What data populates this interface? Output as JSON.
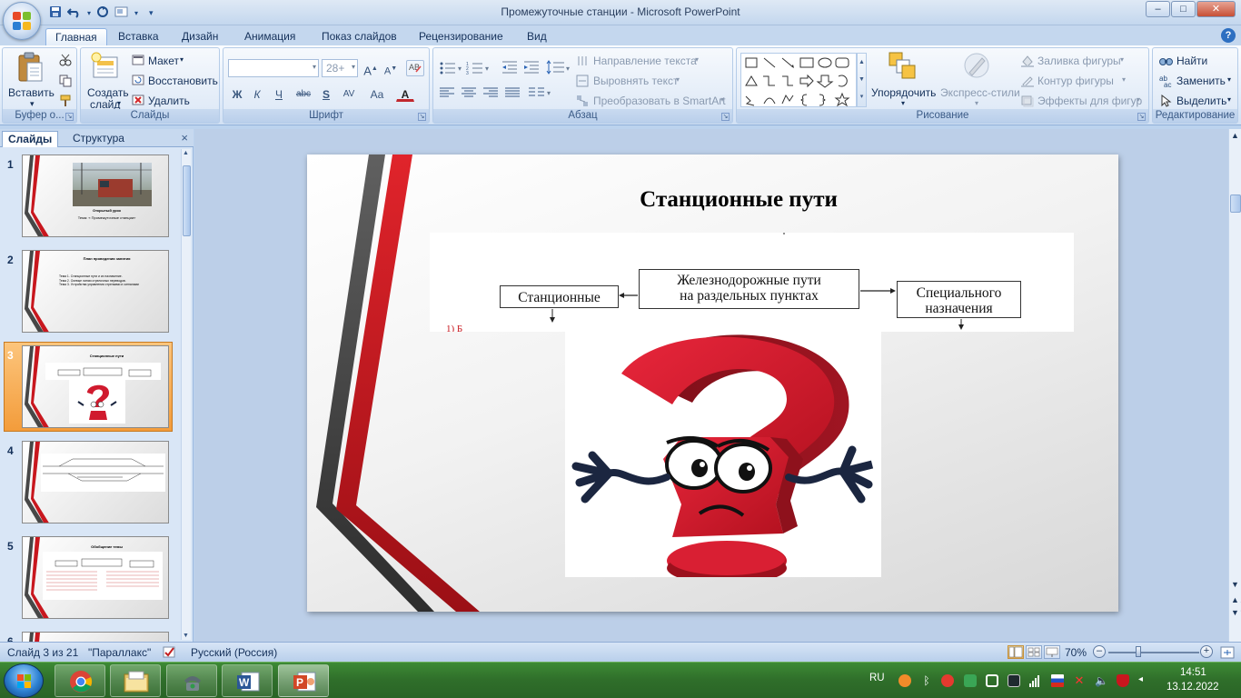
{
  "window": {
    "title": "Промежуточные станции - Microsoft PowerPoint",
    "minimize": "–",
    "maximize": "□",
    "close": "✕"
  },
  "ribbon_tabs": [
    "Главная",
    "Вставка",
    "Дизайн",
    "Анимация",
    "Показ слайдов",
    "Рецензирование",
    "Вид"
  ],
  "ribbon": {
    "clipboard": {
      "paste": "Вставить",
      "label": "Буфер о..."
    },
    "slides": {
      "create1": "Создать",
      "create2": "слайд",
      "layout": "Макет",
      "reset": "Восстановить",
      "delete": "Удалить",
      "label": "Слайды"
    },
    "font": {
      "size_value": "28+",
      "label": "Шрифт",
      "buttons": [
        "Ж",
        "К",
        "Ч",
        "abc",
        "S",
        "AV",
        "Aa",
        "A"
      ]
    },
    "paragraph": {
      "text_direction": "Направление текста",
      "align_text": "Выровнять текст",
      "smartart": "Преобразовать в SmartArt",
      "label": "Абзац"
    },
    "drawing": {
      "arrange1": "Упорядочить",
      "quick_styles": "Экспресс-стили",
      "fill": "Заливка фигуры",
      "outline": "Контур фигуры",
      "effects": "Эффекты для фигур",
      "label": "Рисование"
    },
    "editing": {
      "find": "Найти",
      "replace": "Заменить",
      "select": "Выделить",
      "label": "Редактирование"
    }
  },
  "pane": {
    "tab_slides": "Слайды",
    "tab_outline": "Структура",
    "close": "×",
    "slides": [
      {
        "num": "1",
        "title": "Открытый урок",
        "text": "Тема: « Промежуточные станции»"
      },
      {
        "num": "2",
        "title": "План проведения занятия",
        "text": "Тема 1. Станционные пути и их назначение.\nТема 2. Осевые линии стрелочных переводов.\nТема 3. Устройства управления стрелками и сигналами"
      },
      {
        "num": "3",
        "title": "Станционные пути",
        "text": ""
      },
      {
        "num": "4",
        "title": "",
        "text": ""
      },
      {
        "num": "5",
        "title": "Обобщение темы",
        "text": ""
      },
      {
        "num": "6",
        "title": "",
        "text": ""
      }
    ]
  },
  "slide": {
    "title": "Станционные пути",
    "diagram": {
      "center_line1": "Железнодорожные пути",
      "center_line2": "на раздельных пунктах",
      "left": "Станционные",
      "right_line1": "Специального",
      "right_line2": "назначения"
    }
  },
  "statusbar": {
    "slide_info": "Слайд 3 из 21",
    "theme": "\"Параллакс\"",
    "language": "Русский (Россия)",
    "zoom": "70%",
    "zoom_pct": 70
  },
  "taskbar": {
    "lang": "RU",
    "time": "14:51",
    "date": "13.12.2022"
  },
  "colors": {
    "slide_red": "#c8171e",
    "slide_dark": "#474747",
    "question_red": "#d01a2e",
    "selection_orange": "#f39c3b"
  },
  "icons": [
    "office-button-icon",
    "save-icon",
    "undo-icon",
    "redo-icon",
    "paste-icon",
    "new-slide-icon",
    "question-mark-image",
    "start-orb-icon",
    "chrome-icon",
    "explorer-icon",
    "word-icon",
    "powerpoint-icon"
  ]
}
